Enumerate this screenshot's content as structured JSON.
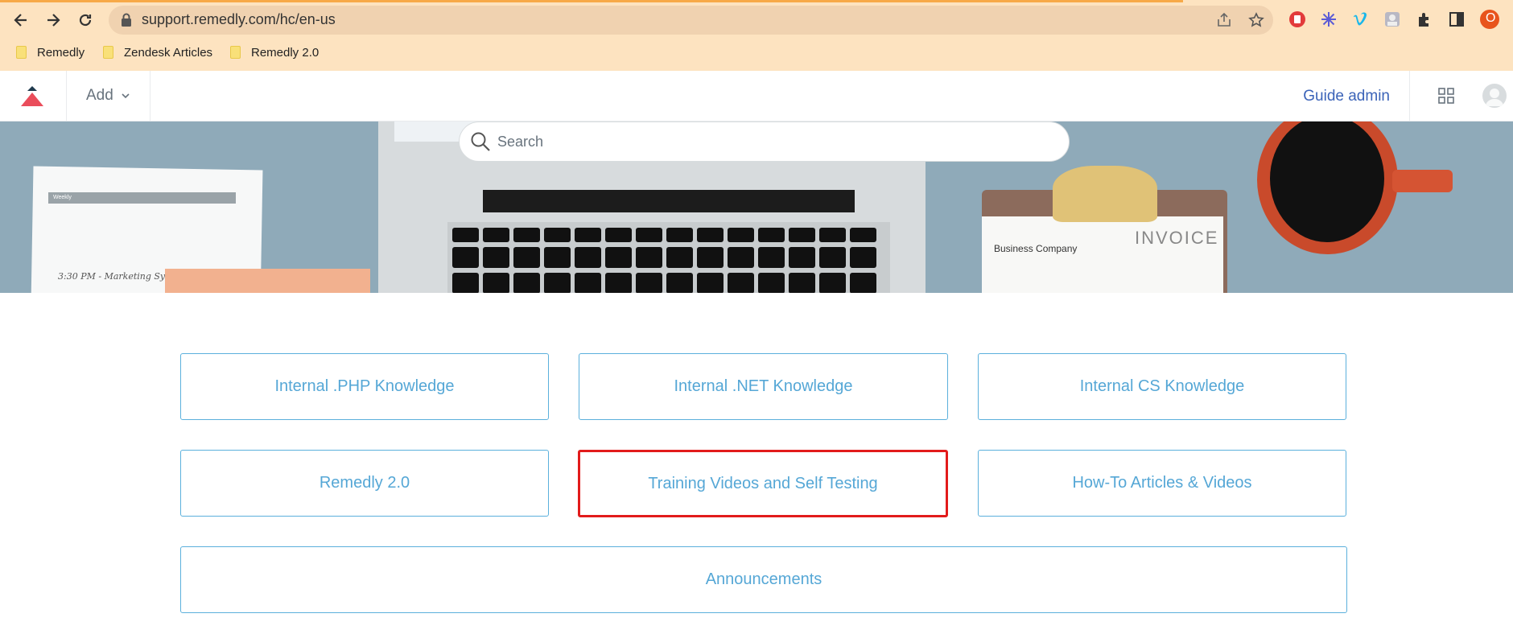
{
  "browser": {
    "url": "support.remedly.com/hc/en-us",
    "bookmarks": [
      "Remedly",
      "Zendesk Articles",
      "Remedly 2.0"
    ],
    "profile_initial": "O"
  },
  "header": {
    "add_label": "Add",
    "guide_admin_label": "Guide admin"
  },
  "hero": {
    "search_placeholder": "Search",
    "paper_title": "Weekly",
    "paper_note": "3:30 PM - Marketing Syst",
    "invoice_company": "Business Company",
    "invoice_title": "INVOICE"
  },
  "categories": [
    "Internal .PHP Knowledge",
    "Internal .NET Knowledge",
    "Internal CS Knowledge",
    "Remedly 2.0",
    "Training Videos and Self Testing",
    "How-To Articles & Videos",
    "Announcements"
  ],
  "highlight_color": "#e21b1b",
  "accent_color": "#55a7d6"
}
